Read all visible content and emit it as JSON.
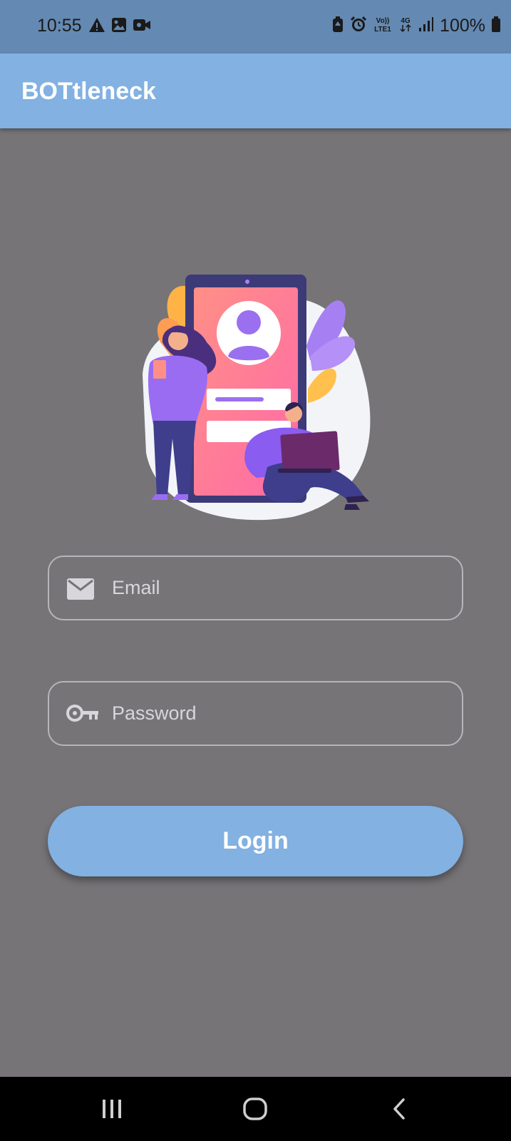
{
  "status_bar": {
    "time": "10:55",
    "battery_text": "100%",
    "left_icons": [
      "warning-icon",
      "gallery-icon",
      "video-icon"
    ],
    "right_icons": [
      "battery-saver-icon",
      "alarm-icon",
      "volte-icon",
      "network-4g-icon",
      "signal-icon",
      "battery-icon"
    ],
    "volte_label": "Vo)) LTE1",
    "network_label": "4G"
  },
  "app_bar": {
    "title": "BOTtleneck"
  },
  "form": {
    "email_placeholder": "Email",
    "email_icon": "mail-icon",
    "password_placeholder": "Password",
    "password_icon": "key-icon",
    "login_label": "Login"
  },
  "colors": {
    "background": "#767477",
    "status_bar": "#6489b2",
    "app_bar": "#82b1e2",
    "button": "#82b1e2",
    "nav_bar": "#000000"
  },
  "nav_bar": {
    "icons": [
      "recents-icon",
      "home-icon",
      "back-icon"
    ]
  }
}
